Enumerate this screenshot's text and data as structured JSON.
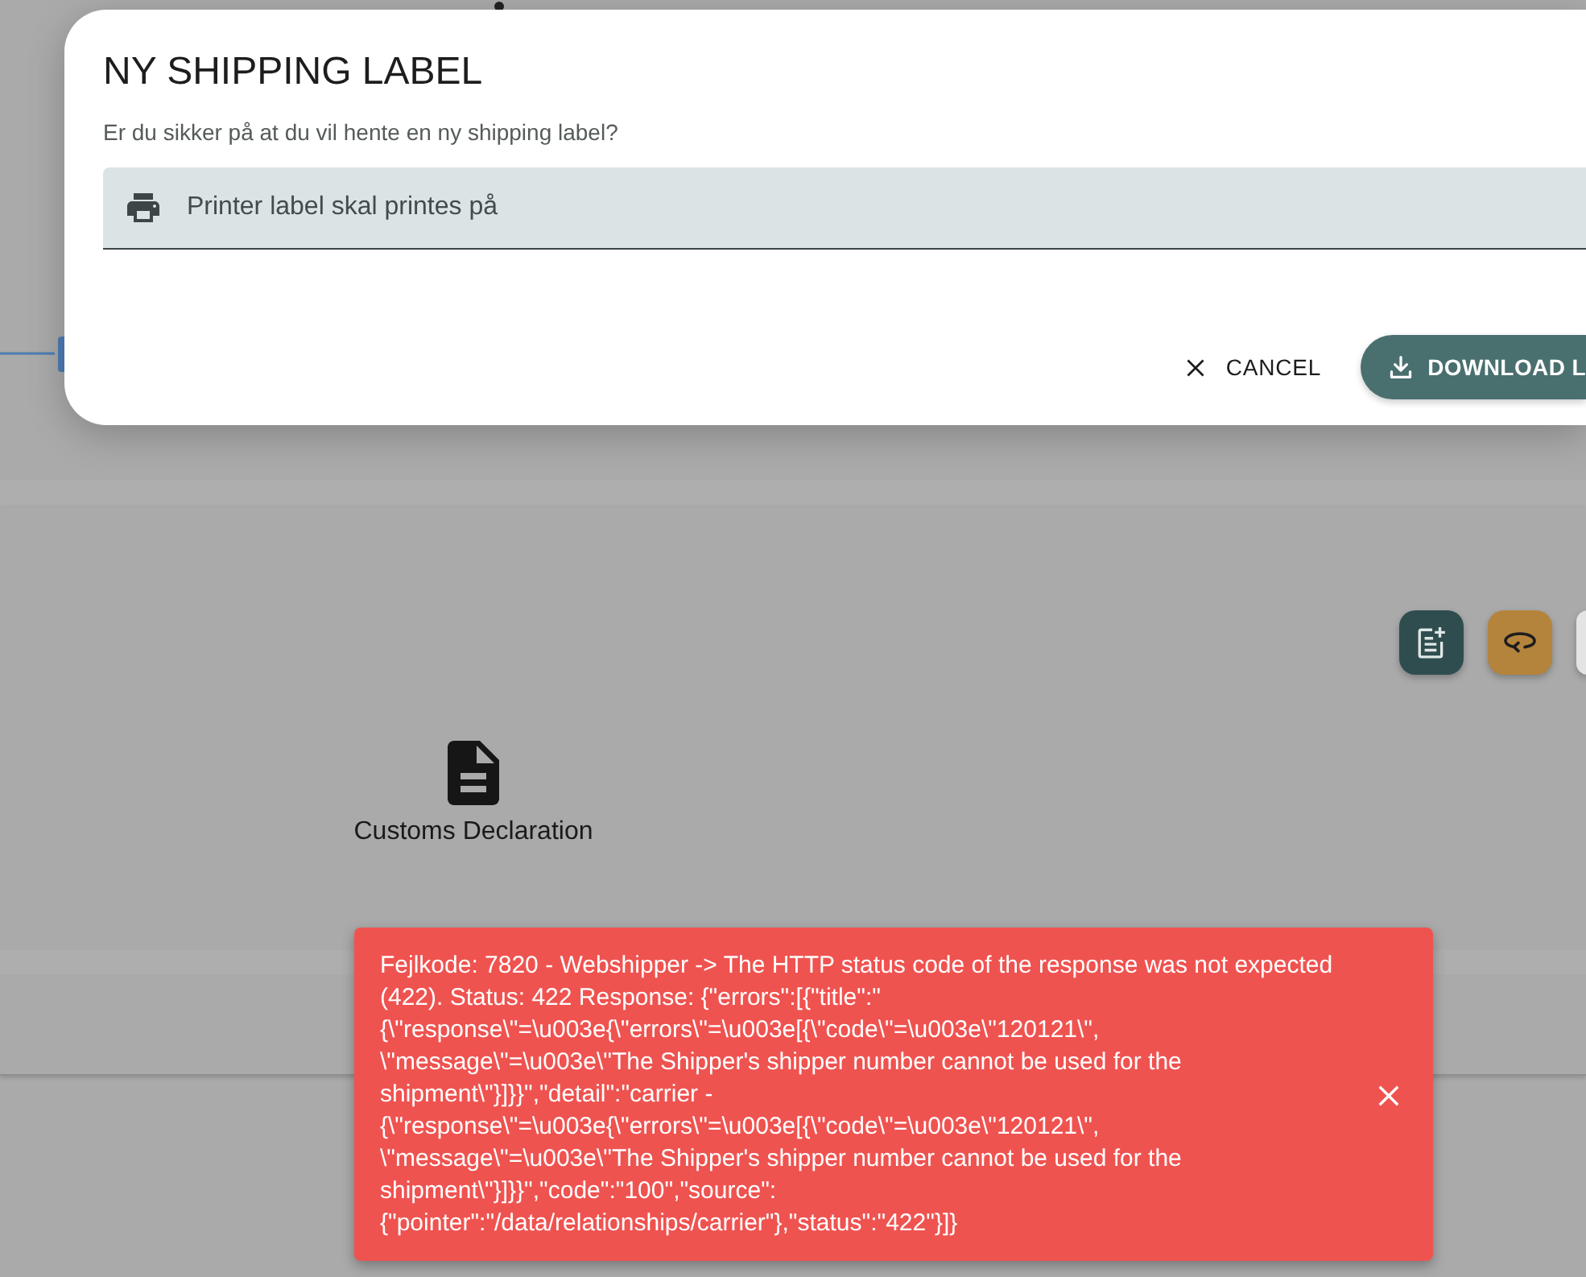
{
  "background": {
    "actions": [
      {
        "kind": "note"
      },
      {
        "kind": "rotate"
      },
      {
        "kind": "blank"
      }
    ],
    "document": {
      "label": "Customs Declaration"
    }
  },
  "dialog": {
    "title": "NY SHIPPING LABEL",
    "message": "Er du sikker på at du vil hente en ny shipping label?",
    "printer_select": {
      "placeholder": "Printer label skal printes på"
    },
    "buttons": [
      {
        "kind": "cancel",
        "label": "CANCEL"
      },
      {
        "kind": "download",
        "label": "DOWNLOAD L"
      }
    ]
  },
  "toast": {
    "kind": "error",
    "message": "Fejlkode: 7820 - Webshipper -> The HTTP status code of the response was not expected (422). Status: 422 Response: {\"errors\":[{\"title\":\"{\\\"response\\\"=\\u003e{\\\"errors\\\"=\\u003e[{\\\"code\\\"=\\u003e\\\"120121\\\", \\\"message\\\"=\\u003e\\\"The Shipper's shipper number cannot be used for the shipment\\\"}]}}\",\"detail\":\"carrier - {\\\"response\\\"=\\u003e{\\\"errors\\\"=\\u003e[{\\\"code\\\"=\\u003e\\\"120121\\\", \\\"message\\\"=\\u003e\\\"The Shipper's shipper number cannot be used for the shipment\\\"}]}}\",\"code\":\"100\",\"source\":{\"pointer\":\"/data/relationships/carrier\"},\"status\":\"422\"}]}"
  }
}
